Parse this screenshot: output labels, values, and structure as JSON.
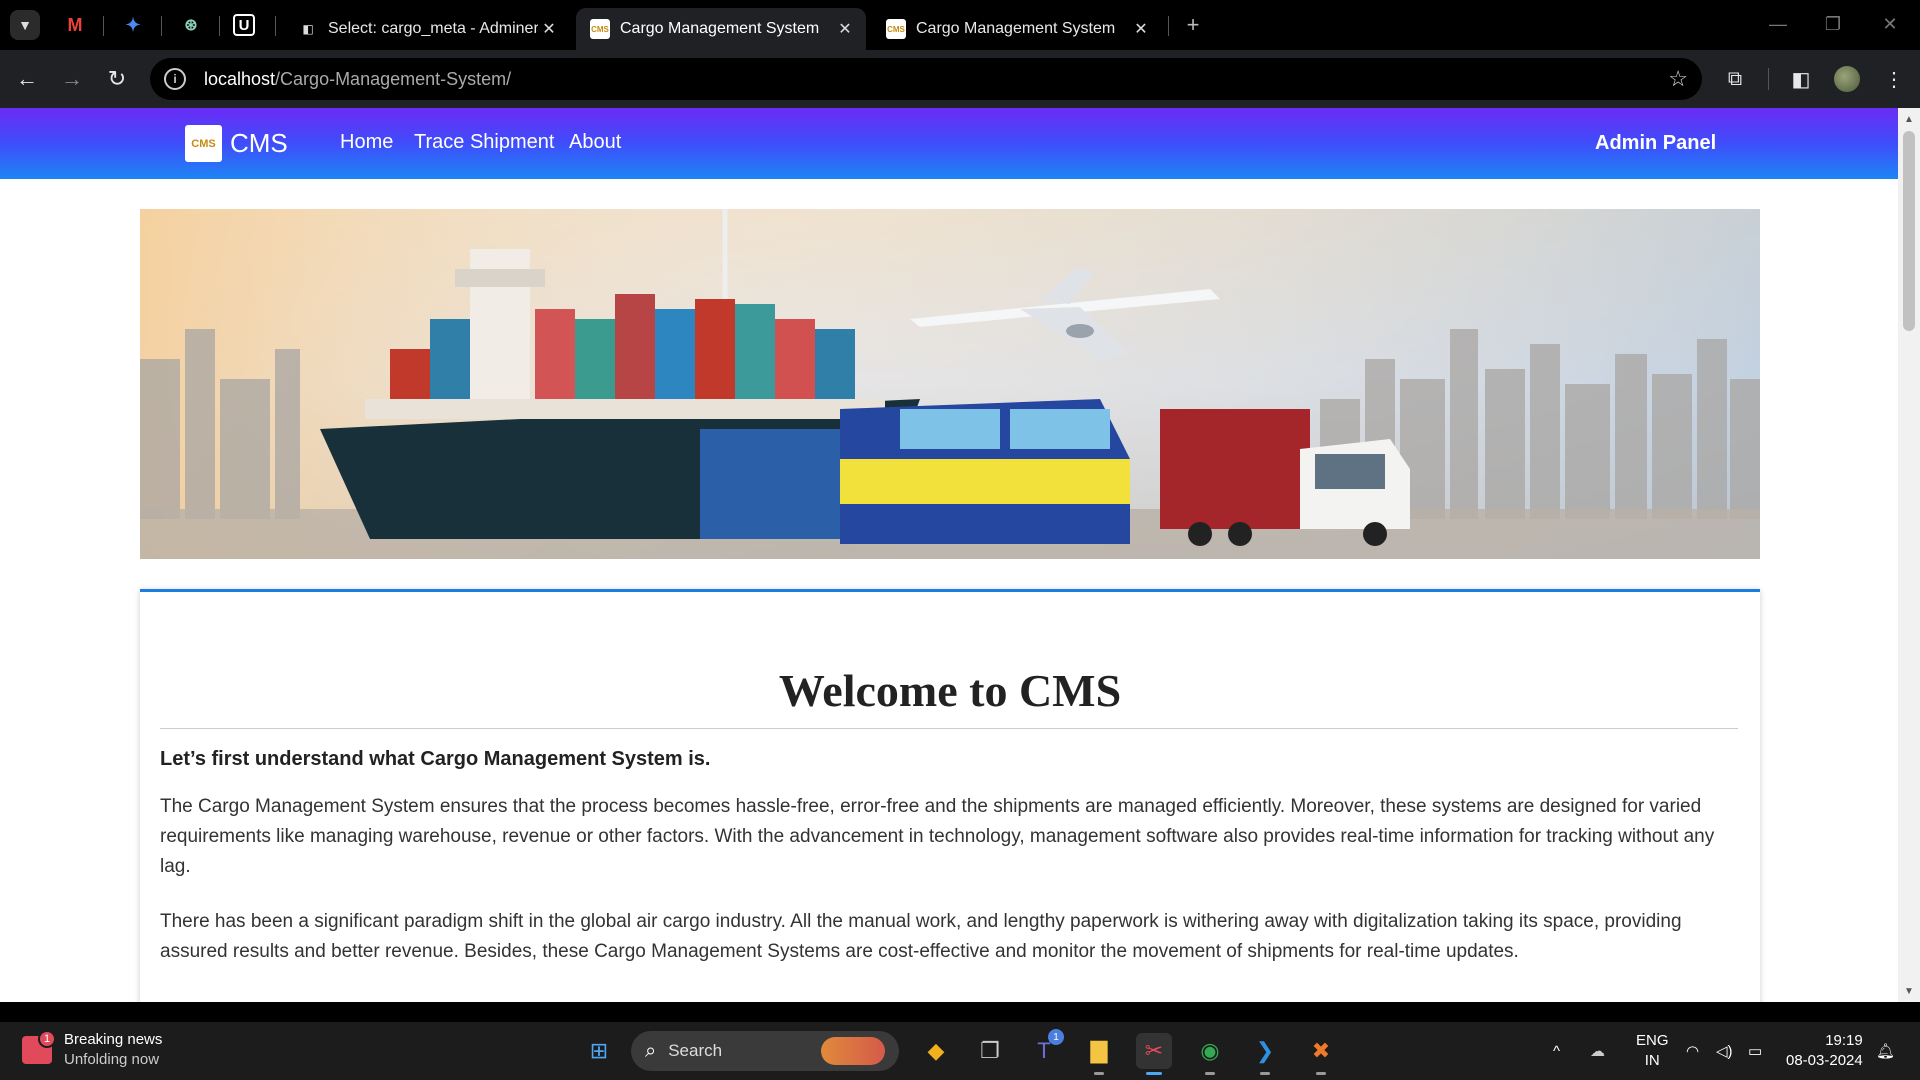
{
  "browser": {
    "tabs": [
      {
        "title": "Select: cargo_meta - Adminer",
        "active": false
      },
      {
        "title": "Cargo Management System",
        "active": true
      },
      {
        "title": "Cargo Management System",
        "active": false
      }
    ],
    "address": {
      "host": "localhost",
      "path": "/Cargo-Management-System/"
    }
  },
  "site": {
    "brand": {
      "logo_text": "CMS",
      "name": "CMS"
    },
    "nav": {
      "home": "Home",
      "trace": "Trace Shipment",
      "about": "About",
      "admin": "Admin Panel"
    },
    "banner_next": "›"
  },
  "content": {
    "heading": "Welcome to CMS",
    "subheading": "Let’s first understand what Cargo Management System is.",
    "para1": "The Cargo Management System ensures that the process becomes hassle-free, error-free and the shipments are managed efficiently. Moreover, these systems are designed for varied requirements like managing warehouse, revenue or other factors. With the advancement in technology, management software also provides real-time information for tracking without any lag.",
    "para2": "There has been a significant paradigm shift in the global air cargo industry. All the manual work, and lengthy paperwork is withering away with digitalization taking its space, providing assured results and better revenue. Besides, these Cargo Management Systems are cost-effective and monitor the movement of shipments for real-time updates."
  },
  "taskbar": {
    "news_title": "Breaking news",
    "news_sub": "Unfolding now",
    "news_badge": "1",
    "search_label": "Search",
    "teams_badge": "1",
    "lang_top": "ENG",
    "lang_bottom": "IN",
    "time": "19:19",
    "date": "08-03-2024"
  },
  "colors": {
    "nav_gradient_top": "#6a2cf5",
    "nav_gradient_bottom": "#1d86f5",
    "card_accent": "#1e7be0"
  }
}
